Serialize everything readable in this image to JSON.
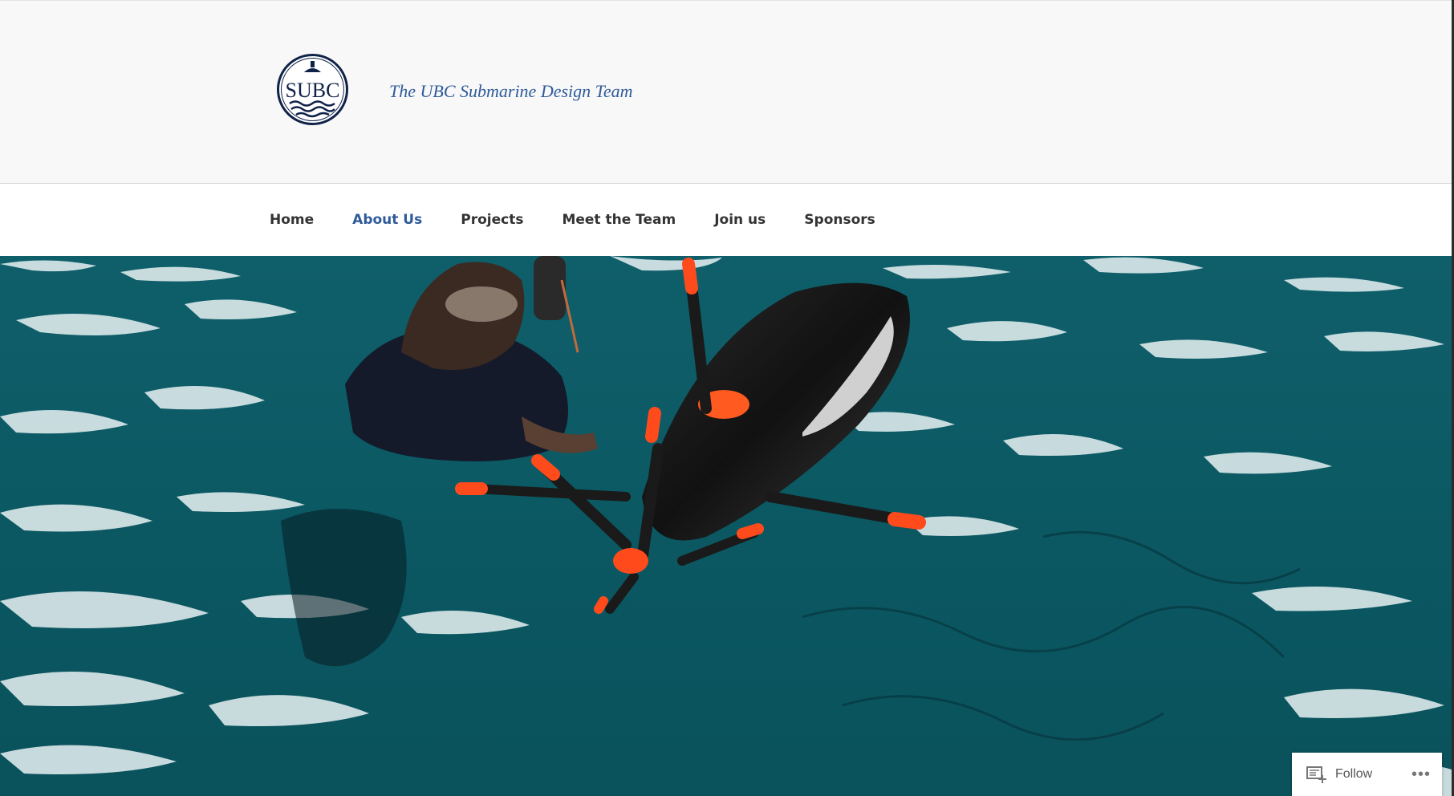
{
  "header": {
    "logo_text": "SUBC",
    "site_description": "The UBC Submarine Design Team"
  },
  "nav": {
    "items": [
      {
        "label": "Home",
        "current": false
      },
      {
        "label": "About Us",
        "current": true
      },
      {
        "label": "Projects",
        "current": false
      },
      {
        "label": "Meet the Team",
        "current": false
      },
      {
        "label": "Join us",
        "current": false
      },
      {
        "label": "Sponsors",
        "current": false
      }
    ]
  },
  "follow_bar": {
    "follow_label": "Follow",
    "more_icon": "ellipsis-icon"
  },
  "colors": {
    "accent": "#2f5b9a",
    "header_bg": "#f8f8f8",
    "water": "#0b5963",
    "propeller_tip": "#ff4a1c"
  }
}
